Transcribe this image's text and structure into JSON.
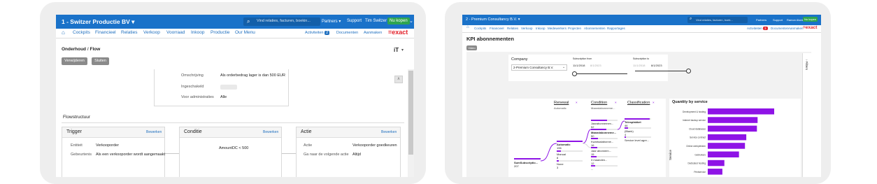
{
  "left": {
    "topbar": {
      "company": "1 - Switzer Productie BV",
      "search_placeholder": "Vind relaties, facturen, boekin...",
      "partners": "Partners",
      "support": "Support",
      "user": "Tim Switzer",
      "buy_now": "Nu kopen"
    },
    "nav": {
      "items": [
        "Cockpits",
        "Financieel",
        "Relaties",
        "Verkoop",
        "Voorraad",
        "Inkoop",
        "Productie",
        "Our Menu"
      ],
      "activities": "Activiteiten",
      "activities_count": "2",
      "documents": "Documenten",
      "create": "Aanmaken",
      "logo": "=exact"
    },
    "page": {
      "breadcrumb_a": "Onderhoud",
      "breadcrumb_sep": "/",
      "breadcrumb_b": "Flow",
      "delete_button": "Verwijderen",
      "close_button": "Sluiten",
      "details": {
        "description_label": "Omschrijving",
        "description_value": "Als orderbedrag lager is dan 500 EUR",
        "enabled_label": "Ingeschakeld",
        "admins_label": "Voor administraties",
        "admins_value": "Alle"
      },
      "flow_title": "Flowstructuur",
      "edit_label": "Bewerken",
      "trigger": {
        "title": "Trigger",
        "entity_label": "Entiteit",
        "entity_value": "Verkooporder",
        "event_label": "Gebeurtenis",
        "event_value": "Als een verkooporder wordt aangemaakt"
      },
      "condition": {
        "title": "Conditie",
        "value": "AmountDC < 500"
      },
      "action": {
        "title": "Actie",
        "action_label": "Actie",
        "action_value": "Verkooporder goedkeuren",
        "next_label": "Ga naar de volgende actie",
        "next_value": "Altijd"
      }
    }
  },
  "right": {
    "topbar": {
      "company": "2 - Premium Consultancy B.V.",
      "search_placeholder": "Vind relaties, facturen, boek...",
      "partners": "Partners",
      "support": "Support",
      "user": "Ramon Alves",
      "buy_now": "Nu kopen"
    },
    "nav": {
      "items": [
        "Cockpits",
        "Financieel",
        "Relaties",
        "Verkoop",
        "Inkoop",
        "Medewerkers",
        "Projecten",
        "Abonnementen",
        "Rapportages"
      ],
      "activities": "Activiteiten",
      "activities_count": "3",
      "documents": "Documenten",
      "create": "Aanmaken",
      "logo": "=exact"
    },
    "page": {
      "title": "KPI abonnementen",
      "video_button": "Video",
      "filters_label": "Filters",
      "company_label": "Company",
      "company_value": "2-Premium Consultancy B.V.",
      "from_label": "Subscription from",
      "from_start": "11/1/2018",
      "from_end": "8/1/2023",
      "to_label": "Subscription to",
      "to_start": "11/1/2018",
      "to_end": "8/1/2023",
      "decomp": {
        "col1": "Renewal",
        "col1_sub": "Automatic",
        "col2": "Condition",
        "col2_sub": "Maandabonneme...",
        "col3": "Classification",
        "root_label": "SumSubscriptio...",
        "root_value": "207",
        "renewal_nodes": [
          {
            "label": "Automatic",
            "value": "196",
            "bar": 1.0
          },
          {
            "label": "Manual",
            "value": "8",
            "bar": 0.15
          },
          {
            "label": "None",
            "value": "3",
            "bar": 0.08
          }
        ],
        "condition_nodes": [
          {
            "label": "Jaarabonnemen...",
            "value": "52",
            "bar": 0.6
          },
          {
            "label": "Maandabonneme...",
            "value": "50",
            "bar": 0.58
          },
          {
            "label": "Kwartaalabonne...",
            "value": "16",
            "bar": 0.25
          },
          {
            "label": "Jaar abonnem...",
            "value": "15",
            "bar": 0.24
          },
          {
            "label": "3 maanden...",
            "value": "12",
            "bar": 0.2
          },
          {
            "label": "...",
            "value": "",
            "bar": 0.15
          }
        ],
        "class_nodes": [
          {
            "label": "Telesplakket",
            "value": "46",
            "bar": 0.95
          },
          {
            "label": "(Blank)",
            "value": "4",
            "bar": 0.12
          },
          {
            "label": "Service level agre...",
            "value": "",
            "bar": 0.05
          }
        ]
      },
      "qty_chart": {
        "title": "Quantity by service",
        "axis_label": "Service"
      }
    }
  },
  "chart_data": {
    "type": "bar",
    "title": "Quantity by service",
    "ylabel": "Service",
    "categories": [
      "Development & hosting",
      "Internet backup service",
      "Cloud databases",
      "Service contract",
      "Online werkplekken",
      "Gebruikers",
      "Dedicated hosting",
      "Printservice"
    ],
    "values": [
      100,
      75,
      74,
      58,
      56,
      47,
      25,
      22
    ],
    "xlim": [
      0,
      100
    ]
  }
}
